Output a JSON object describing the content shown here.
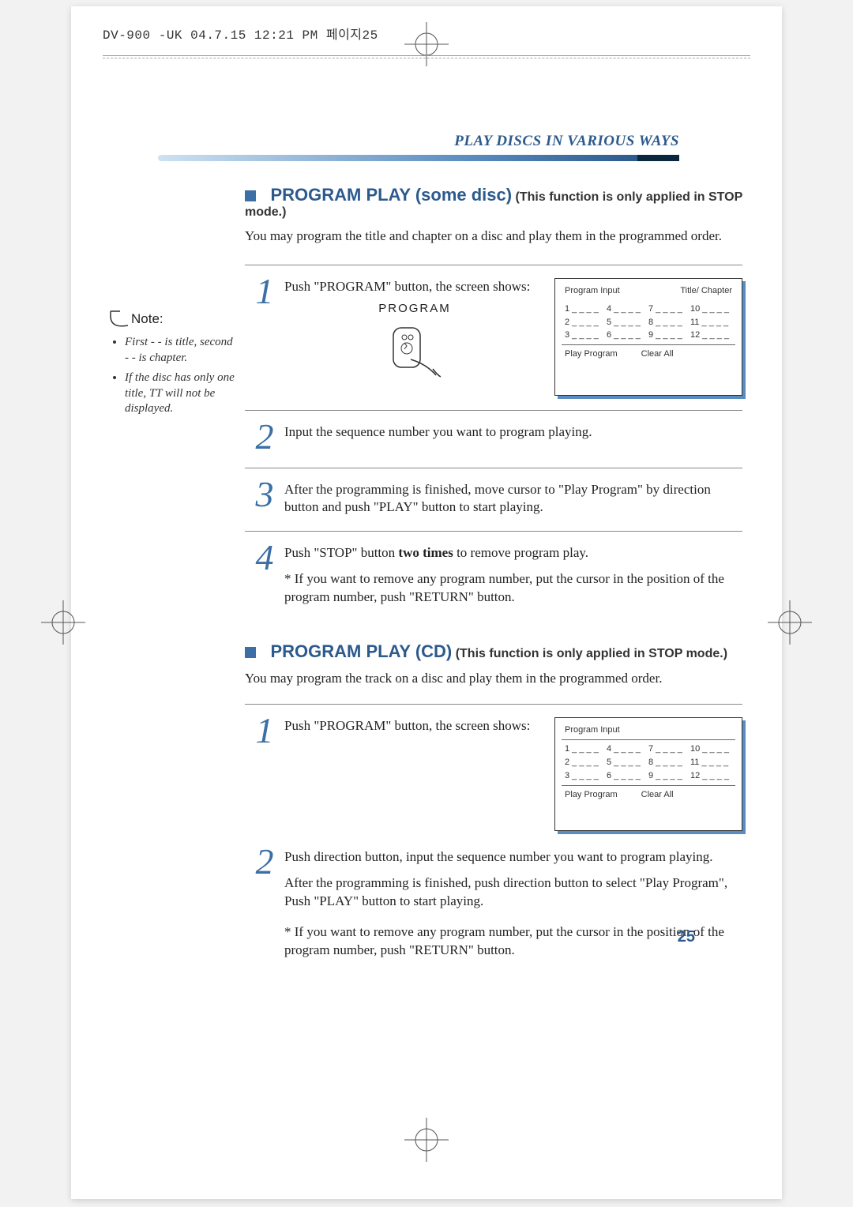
{
  "header": {
    "docline": "DV-900 -UK  04.7.15  12:21 PM  페이지25"
  },
  "section": {
    "title": "PLAY DISCS IN VARIOUS WAYS"
  },
  "block1": {
    "heading_strong": "PROGRAM PLAY (some disc)",
    "heading_note": " (This function is only applied in STOP mode.)",
    "intro": "You may program the title and chapter on a disc and play them in the programmed order."
  },
  "note": {
    "label": "Note:",
    "items": [
      "First  - - is title, second - - is chapter.",
      "If the disc has only one title, TT will not be displayed."
    ]
  },
  "steps": [
    {
      "num": "1",
      "text": "Push \"PROGRAM\" button, the screen shows:",
      "program_label": "PROGRAM"
    },
    {
      "num": "2",
      "text": "Input the sequence number you want to program playing."
    },
    {
      "num": "3",
      "text": "After the programming is finished, move cursor to \"Play Program\" by direction button and push \"PLAY\" button to start playing."
    },
    {
      "num": "4",
      "text": "Push \"STOP\" button ",
      "bold": "two times",
      "text_after": " to remove program play.",
      "sub": "* If you want to remove any program number, put the cursor in the position of the program number, push \"RETURN\" button."
    }
  ],
  "panel1": {
    "head_left": "Program Input",
    "head_right": "Title/ Chapter",
    "cells": [
      [
        "1 _ _ _ _",
        "4 _ _ _ _",
        "7 _ _ _ _",
        "10 _ _ _ _"
      ],
      [
        "2 _ _ _ _",
        "5 _ _ _ _",
        "8 _ _ _ _",
        "11 _ _ _ _"
      ],
      [
        "3 _ _ _ _",
        "6 _ _ _ _",
        "9 _ _ _ _",
        "12 _ _ _ _"
      ]
    ],
    "action_left": "Play Program",
    "action_right": "Clear All"
  },
  "block2": {
    "heading_strong": "PROGRAM PLAY (CD)",
    "heading_note": " (This function is only applied in STOP mode.)",
    "intro": "You may program the track on a disc and play them in the programmed order."
  },
  "steps_cd": [
    {
      "num": "1",
      "text": "Push \"PROGRAM\" button, the screen shows:"
    },
    {
      "num": "2",
      "text": "Push direction button, input the sequence number you want to program playing.",
      "after": "After the programming is finished, push direction button to select \"Play Program\", Push \"PLAY\" button to start playing.",
      "sub": "*  If you want to remove any program number, put the cursor in the position of the program number, push \"RETURN\" button."
    }
  ],
  "panel2": {
    "head_left": "Program Input",
    "cells": [
      [
        "1 _ _ _ _",
        "4 _ _ _ _",
        "7 _ _ _ _",
        "10 _ _ _ _"
      ],
      [
        "2 _ _ _ _",
        "5 _ _ _ _",
        "8 _ _ _ _",
        "11 _ _ _ _"
      ],
      [
        "3 _ _ _ _",
        "6 _ _ _ _",
        "9 _ _ _ _",
        "12 _ _ _ _"
      ]
    ],
    "action_left": "Play Program",
    "action_right": "Clear All"
  },
  "page_number": "25"
}
